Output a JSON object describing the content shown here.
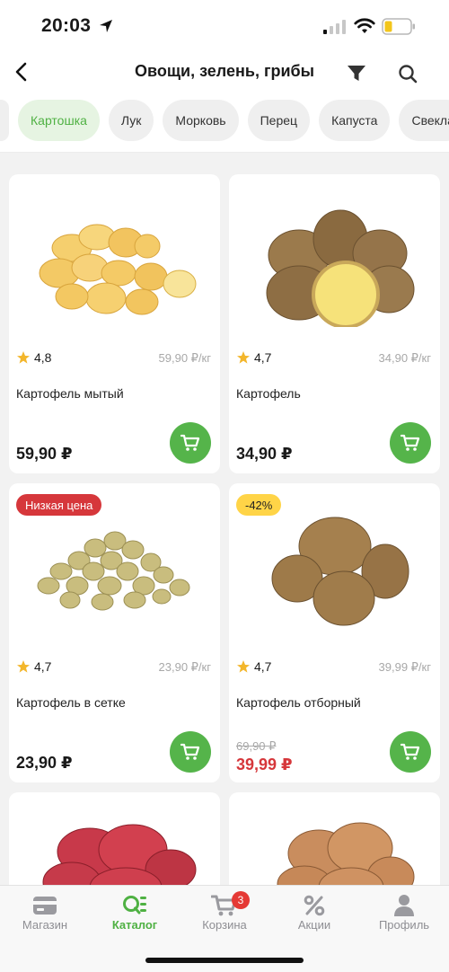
{
  "status": {
    "time": "20:03"
  },
  "header": {
    "title": "Овощи, зелень, грибы"
  },
  "chips": [
    "Картошка",
    "Лук",
    "Морковь",
    "Перец",
    "Капуста",
    "Свекла"
  ],
  "products": [
    {
      "rating": "4,8",
      "unit_price": "59,90 ₽/кг",
      "name": "Картофель мытый",
      "price": "59,90 ₽"
    },
    {
      "rating": "4,7",
      "unit_price": "34,90 ₽/кг",
      "name": "Картофель",
      "price": "34,90 ₽"
    },
    {
      "badge": "Низкая цена",
      "rating": "4,7",
      "unit_price": "23,90 ₽/кг",
      "name": "Картофель в сетке",
      "price": "23,90 ₽"
    },
    {
      "badge": "-42%",
      "rating": "4,7",
      "unit_price": "39,99 ₽/кг",
      "name": "Картофель отборный",
      "old_price": "69,90 ₽",
      "price": "39,99 ₽"
    }
  ],
  "tabs": [
    {
      "label": "Магазин",
      "icon": "card-icon"
    },
    {
      "label": "Каталог",
      "icon": "catalog-icon"
    },
    {
      "label": "Корзина",
      "icon": "cart-icon",
      "badge": "3"
    },
    {
      "label": "Акции",
      "icon": "percent-icon"
    },
    {
      "label": "Профиль",
      "icon": "profile-icon"
    }
  ],
  "colors": {
    "accent": "#55b44a",
    "sale": "#d6373b",
    "badge_yellow": "#ffd447"
  }
}
